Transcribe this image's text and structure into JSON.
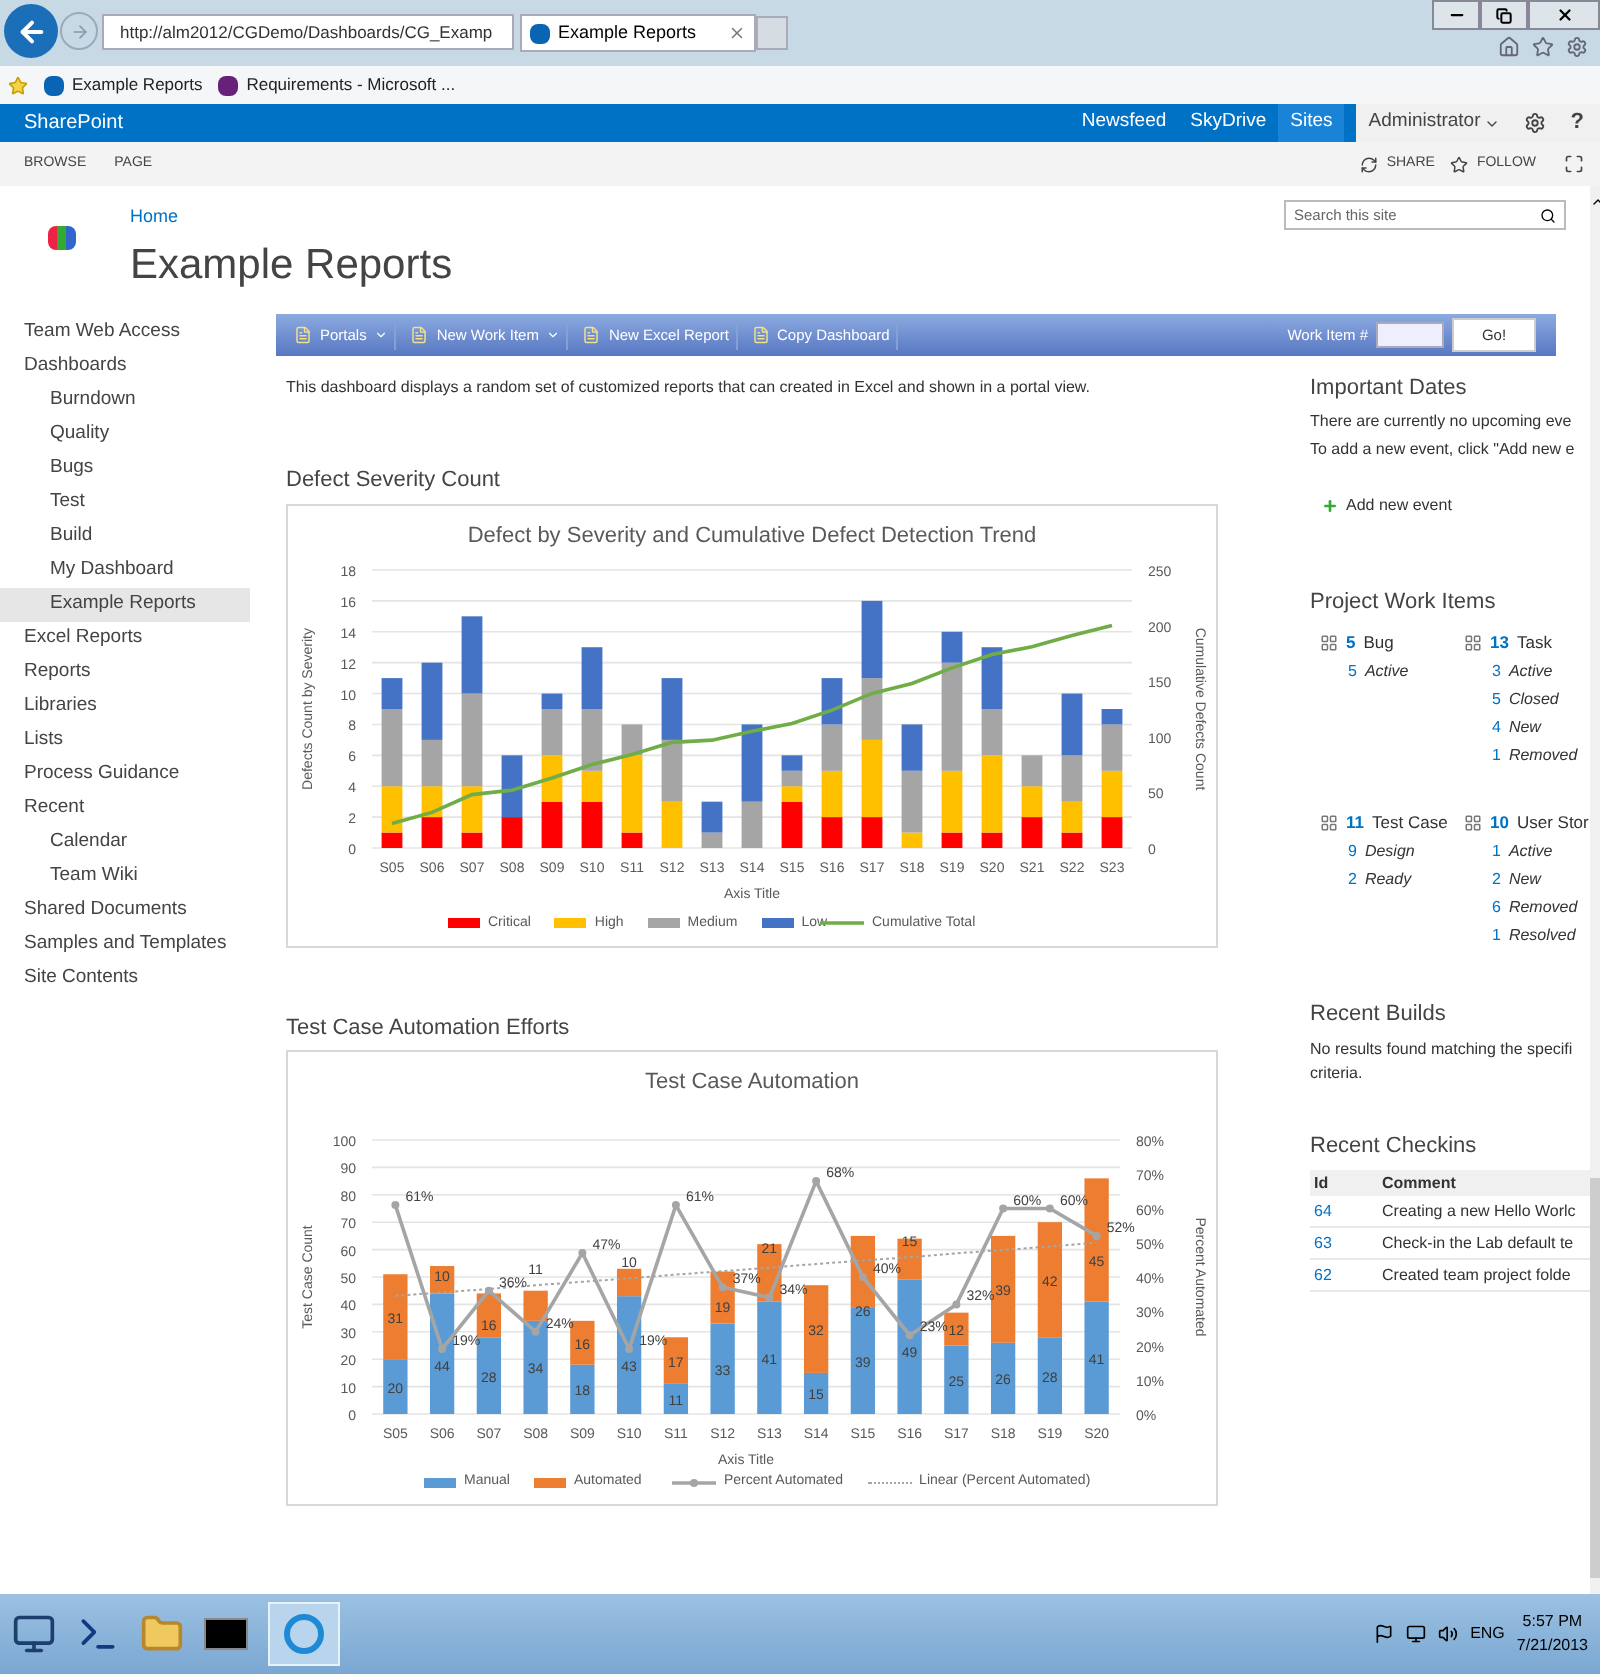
{
  "browser": {
    "address": "http://alm2012/CGDemo/Dashboards/CG_Examp",
    "tab_title": "Example Reports",
    "favorites": [
      "Example Reports",
      "Requirements - Microsoft ..."
    ]
  },
  "suitebar": {
    "brand": "SharePoint",
    "links": [
      {
        "label": "Newsfeed",
        "selected": false
      },
      {
        "label": "SkyDrive",
        "selected": false
      },
      {
        "label": "Sites",
        "selected": true
      }
    ],
    "user": "Administrator",
    "help": "?"
  },
  "ribbon": {
    "tabs": [
      "BROWSE",
      "PAGE"
    ],
    "actions": [
      "SHARE",
      "FOLLOW"
    ]
  },
  "site": {
    "breadcrumb": "Home",
    "title": "Example Reports",
    "search_placeholder": "Search this site"
  },
  "nav": [
    {
      "label": "Team Web Access",
      "selected": false
    },
    {
      "label": "Dashboards",
      "selected": false,
      "children": [
        {
          "label": "Burndown",
          "selected": false
        },
        {
          "label": "Quality",
          "selected": false
        },
        {
          "label": "Bugs",
          "selected": false
        },
        {
          "label": "Test",
          "selected": false
        },
        {
          "label": "Build",
          "selected": false
        },
        {
          "label": "My Dashboard",
          "selected": false
        },
        {
          "label": "Example Reports",
          "selected": true
        }
      ]
    },
    {
      "label": "Excel Reports",
      "selected": false
    },
    {
      "label": "Reports",
      "selected": false
    },
    {
      "label": "Libraries",
      "selected": false
    },
    {
      "label": "Lists",
      "selected": false
    },
    {
      "label": "Process Guidance",
      "selected": false
    },
    {
      "label": "Recent",
      "selected": false,
      "children": [
        {
          "label": "Calendar",
          "selected": false
        },
        {
          "label": "Team Wiki",
          "selected": false
        }
      ]
    },
    {
      "label": "Shared Documents",
      "selected": false
    },
    {
      "label": "Samples and Templates",
      "selected": false
    },
    {
      "label": "Site Contents",
      "selected": false
    }
  ],
  "toolbar": {
    "buttons": [
      {
        "label": "Portals",
        "dropdown": true
      },
      {
        "label": "New Work Item",
        "dropdown": true
      },
      {
        "label": "New Excel Report",
        "dropdown": false
      },
      {
        "label": "Copy Dashboard",
        "dropdown": false
      }
    ],
    "work_item_label": "Work Item #",
    "go": "Go!"
  },
  "description": "This dashboard displays a random set of customized reports that can created in Excel and shown in a portal view.",
  "sections": [
    {
      "title": "Defect Severity Count",
      "chart_data": {
        "type": "bar",
        "stacked": true,
        "grid": true,
        "legend": "bottom",
        "title": "Defect by Severity and Cumulative Defect Detection Trend",
        "xlabel": "Axis Title",
        "ylabel": "Defects Count by Severity",
        "categories": [
          "S05",
          "S06",
          "S07",
          "S08",
          "S09",
          "S10",
          "S11",
          "S12",
          "S13",
          "S14",
          "S15",
          "S16",
          "S17",
          "S18",
          "S19",
          "S20",
          "S21",
          "S22",
          "S23"
        ],
        "ylim": [
          0,
          18
        ],
        "yticks": [
          0,
          2,
          4,
          6,
          8,
          10,
          12,
          14,
          16,
          18
        ],
        "series": [
          {
            "name": "Critical",
            "color": "#ff0000",
            "values": [
              1,
              2,
              1,
              2,
              3,
              3,
              1,
              0,
              0,
              0,
              3,
              2,
              2,
              0,
              1,
              1,
              2,
              1,
              2
            ]
          },
          {
            "name": "High",
            "color": "#ffc000",
            "values": [
              3,
              2,
              3,
              0,
              3,
              2,
              5,
              3,
              0,
              0,
              1,
              3,
              5,
              1,
              4,
              5,
              2,
              2,
              3
            ]
          },
          {
            "name": "Medium",
            "color": "#a5a5a5",
            "values": [
              5,
              3,
              6,
              0,
              3,
              4,
              2,
              4,
              1,
              3,
              1,
              3,
              4,
              4,
              7,
              3,
              2,
              3,
              3
            ]
          },
          {
            "name": "Low",
            "color": "#4472c4",
            "values": [
              2,
              5,
              5,
              4,
              1,
              4,
              0,
              4,
              2,
              5,
              1,
              3,
              5,
              3,
              2,
              4,
              0,
              4,
              1
            ]
          }
        ]
      },
      "overlay": {
        "chart_data": {
          "type": "line",
          "legend": "bottom",
          "ylabel": "Cumulative Defects Count",
          "ylim": [
            0,
            250
          ],
          "yticks": [
            0,
            50,
            100,
            150,
            200,
            250
          ],
          "series": [
            {
              "name": "Cumulative Total",
              "color": "#70ad47",
              "values": [
                22,
                32,
                48,
                52,
                63,
                75,
                84,
                95,
                97,
                105,
                112,
                124,
                139,
                148,
                162,
                174,
                181,
                191,
                200
              ]
            }
          ]
        }
      }
    },
    {
      "title": "Test Case Automation Efforts",
      "chart_data": {
        "type": "bar",
        "stacked": true,
        "grid": true,
        "legend": "bottom",
        "data_labels": true,
        "title": "Test Case Automation",
        "xlabel": "Axis Title",
        "ylabel": "Test Case Count",
        "categories": [
          "S05",
          "S06",
          "S07",
          "S08",
          "S09",
          "S10",
          "S11",
          "S12",
          "S13",
          "S14",
          "S15",
          "S16",
          "S17",
          "S18",
          "S19",
          "S20"
        ],
        "ylim": [
          0,
          100
        ],
        "yticks": [
          0,
          10,
          20,
          30,
          40,
          50,
          60,
          70,
          80,
          90,
          100
        ],
        "series": [
          {
            "name": "Manual",
            "color": "#5b9bd5",
            "values": [
              20,
              44,
              28,
              34,
              18,
              43,
              11,
              33,
              41,
              15,
              39,
              49,
              25,
              26,
              28,
              41
            ]
          },
          {
            "name": "Automated",
            "color": "#ed7d31",
            "values": [
              31,
              10,
              16,
              11,
              16,
              10,
              17,
              19,
              21,
              32,
              26,
              15,
              12,
              39,
              42,
              45
            ]
          }
        ]
      },
      "overlay": {
        "chart_data": {
          "type": "line",
          "legend": "bottom",
          "ylabel": "Percent Automated",
          "ylim": [
            0,
            80
          ],
          "yticks": [
            {
              "value": 0,
              "label": "0%"
            },
            {
              "value": 10,
              "label": "10%"
            },
            {
              "value": 20,
              "label": "20%"
            },
            {
              "value": 30,
              "label": "30%"
            },
            {
              "value": 40,
              "label": "40%"
            },
            {
              "value": 50,
              "label": "50%"
            },
            {
              "value": 60,
              "label": "60%"
            },
            {
              "value": 70,
              "label": "70%"
            },
            {
              "value": 80,
              "label": "80%"
            }
          ],
          "value_labels": [
            "61%",
            "19%",
            "36%",
            "24%",
            "47%",
            "19%",
            "61%",
            "37%",
            "34%",
            "68%",
            "40%",
            "23%",
            "32%",
            "60%",
            "60%",
            "52%"
          ],
          "series": [
            {
              "name": "Percent Automated",
              "color": "#a5a5a5",
              "marker": "o",
              "values": [
                61,
                19,
                36,
                24,
                47,
                19,
                61,
                37,
                34,
                68,
                40,
                23,
                32,
                60,
                60,
                52
              ]
            },
            {
              "name": "Linear (Percent Automated)",
              "color": "#a5a5a5",
              "line_style": "dotted",
              "values": [
                34.5,
                35.5,
                36.5,
                37.6,
                38.6,
                39.6,
                40.7,
                41.7,
                42.7,
                43.8,
                44.8,
                45.8,
                46.9,
                47.9,
                48.9,
                50
              ]
            }
          ]
        }
      }
    }
  ],
  "important_dates": {
    "title": "Important Dates",
    "lines": [
      "There are currently no upcoming eve",
      "To add a new event, click \"Add new e"
    ],
    "add": "Add new event"
  },
  "work_items": {
    "title": "Project Work Items",
    "groups": [
      {
        "count": "5",
        "type": "Bug",
        "states": [
          {
            "count": "5",
            "state": "Active"
          }
        ]
      },
      {
        "count": "13",
        "type": "Task",
        "states": [
          {
            "count": "3",
            "state": "Active"
          },
          {
            "count": "5",
            "state": "Closed"
          },
          {
            "count": "4",
            "state": "New"
          },
          {
            "count": "1",
            "state": "Removed"
          }
        ]
      },
      {
        "count": "11",
        "type": "Test Case",
        "states": [
          {
            "count": "9",
            "state": "Design"
          },
          {
            "count": "2",
            "state": "Ready"
          }
        ]
      },
      {
        "count": "10",
        "type": "User Stor",
        "states": [
          {
            "count": "1",
            "state": "Active"
          },
          {
            "count": "2",
            "state": "New"
          },
          {
            "count": "6",
            "state": "Removed"
          },
          {
            "count": "1",
            "state": "Resolved"
          }
        ]
      }
    ]
  },
  "recent_builds": {
    "title": "Recent Builds",
    "text": "No results found matching the specifi criteria."
  },
  "recent_checkins": {
    "title": "Recent Checkins",
    "columns": [
      "Id",
      "Comment"
    ],
    "rows": [
      {
        "id": "64",
        "comment": "Creating a new Hello Worlc"
      },
      {
        "id": "63",
        "comment": "Check-in the Lab default te"
      },
      {
        "id": "62",
        "comment": "Created team project folde"
      }
    ]
  },
  "taskbar": {
    "language": "ENG",
    "time": "5:57 PM",
    "date": "7/21/2013"
  }
}
